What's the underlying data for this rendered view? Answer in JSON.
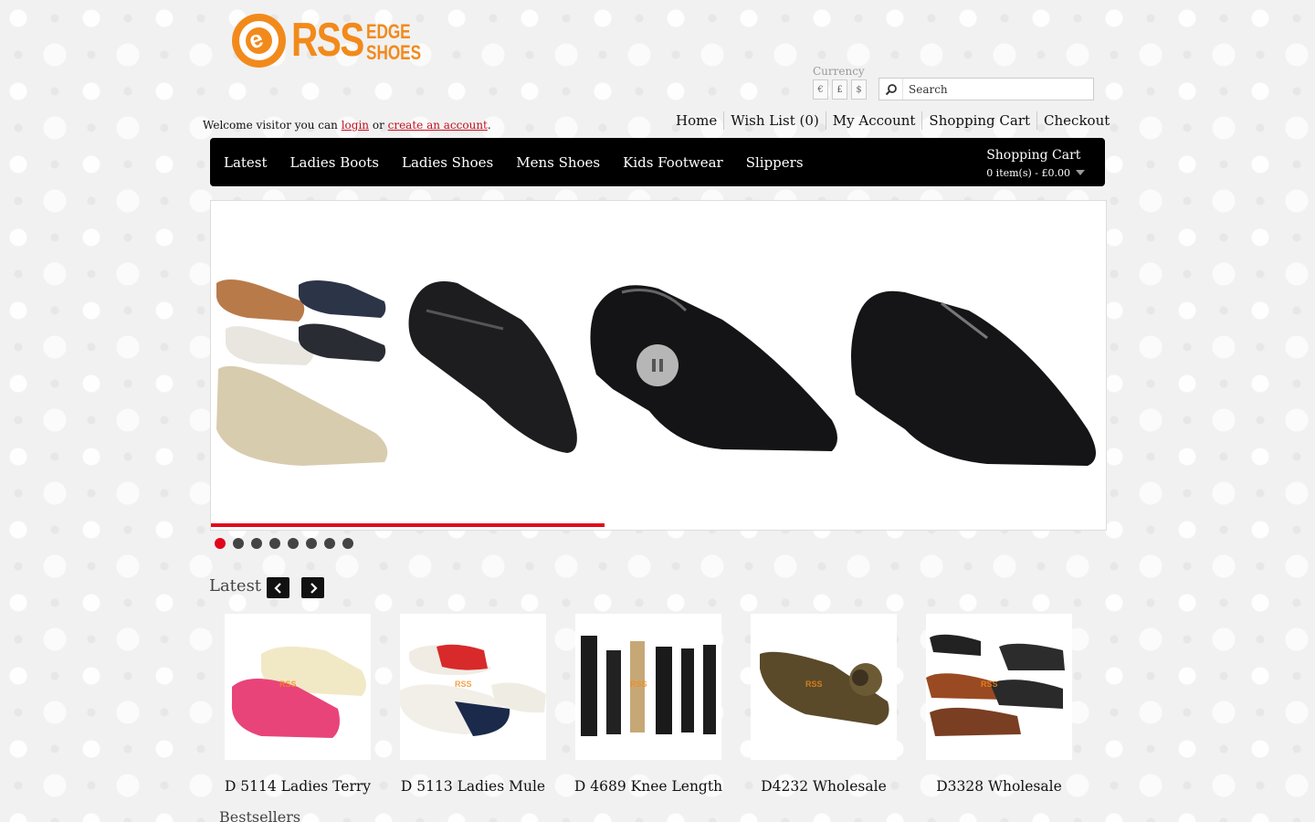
{
  "logo": {
    "mark_letter": "e",
    "word_main": "RSS",
    "word_top": "EDGE",
    "word_bottom": "SHOES"
  },
  "currency": {
    "label": "Currency",
    "options": [
      "€",
      "£",
      "$"
    ]
  },
  "search": {
    "placeholder": "Search"
  },
  "welcome": {
    "prefix": "Welcome visitor you can ",
    "login": "login",
    "middle": " or ",
    "create": "create an account",
    "suffix": "."
  },
  "top_links": [
    "Home",
    "Wish List (0)",
    "My Account",
    "Shopping Cart",
    "Checkout"
  ],
  "menu": {
    "items": [
      "Latest",
      "Ladies Boots",
      "Ladies Shoes",
      "Mens Shoes",
      "Kids Footwear",
      "Slippers"
    ]
  },
  "cart": {
    "title": "Shopping Cart",
    "total": "0 item(s) - £0.00"
  },
  "slider": {
    "slide_count": 8,
    "active_index": 0,
    "progress": 0.44
  },
  "latest": {
    "title": "Latest",
    "watermark": "RSS",
    "products": [
      "D 5114 Ladies Terry",
      "D 5113 Ladies Mule",
      "D 4689 Knee Length",
      "D4232 Wholesale",
      "D3328 Wholesale"
    ]
  },
  "bestsellers": {
    "title": "Bestsellers"
  },
  "colors": {
    "brand_orange": "#f28a1b",
    "accent_red": "#e2061b",
    "menu_bg": "#000000",
    "link_red": "#c1121f"
  }
}
